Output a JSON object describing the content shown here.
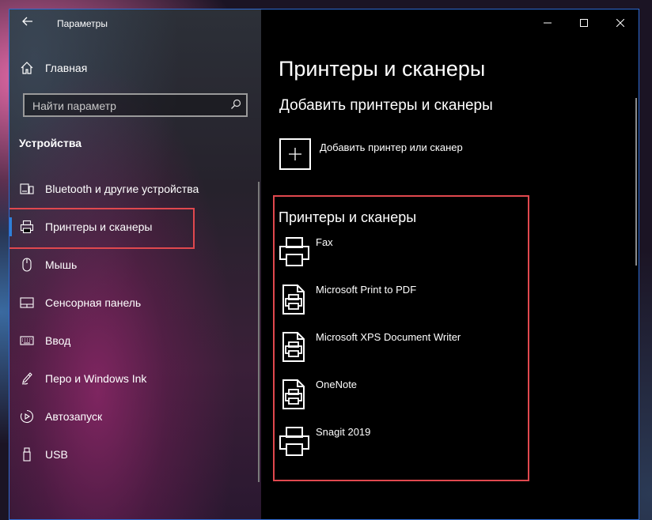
{
  "window": {
    "title": "Параметры"
  },
  "nav": {
    "home_label": "Главная",
    "search_placeholder": "Найти параметр",
    "section_title": "Устройства",
    "items": [
      {
        "label": "Bluetooth и другие устройства",
        "icon": "bluetooth-devices-icon"
      },
      {
        "label": "Принтеры и сканеры",
        "icon": "printer-icon",
        "selected": true
      },
      {
        "label": "Мышь",
        "icon": "mouse-icon"
      },
      {
        "label": "Сенсорная панель",
        "icon": "touchpad-icon"
      },
      {
        "label": "Ввод",
        "icon": "keyboard-icon"
      },
      {
        "label": "Перо и Windows Ink",
        "icon": "pen-icon"
      },
      {
        "label": "Автозапуск",
        "icon": "autoplay-icon"
      },
      {
        "label": "USB",
        "icon": "usb-icon"
      }
    ]
  },
  "main": {
    "page_title": "Принтеры и сканеры",
    "add_section_title": "Добавить принтеры и сканеры",
    "add_label": "Добавить принтер или сканер",
    "list_title": "Принтеры и сканеры",
    "printers": [
      {
        "name": "Fax",
        "icon": "printer-icon"
      },
      {
        "name": "Microsoft Print to PDF",
        "icon": "document-printer-icon"
      },
      {
        "name": "Microsoft XPS Document Writer",
        "icon": "document-printer-icon"
      },
      {
        "name": "OneNote",
        "icon": "document-printer-icon"
      },
      {
        "name": "Snagit 2019",
        "icon": "printer-icon"
      }
    ]
  },
  "colors": {
    "accent": "#2e7fd9",
    "highlight": "#e0484e",
    "window_border": "#2e6bd3"
  }
}
